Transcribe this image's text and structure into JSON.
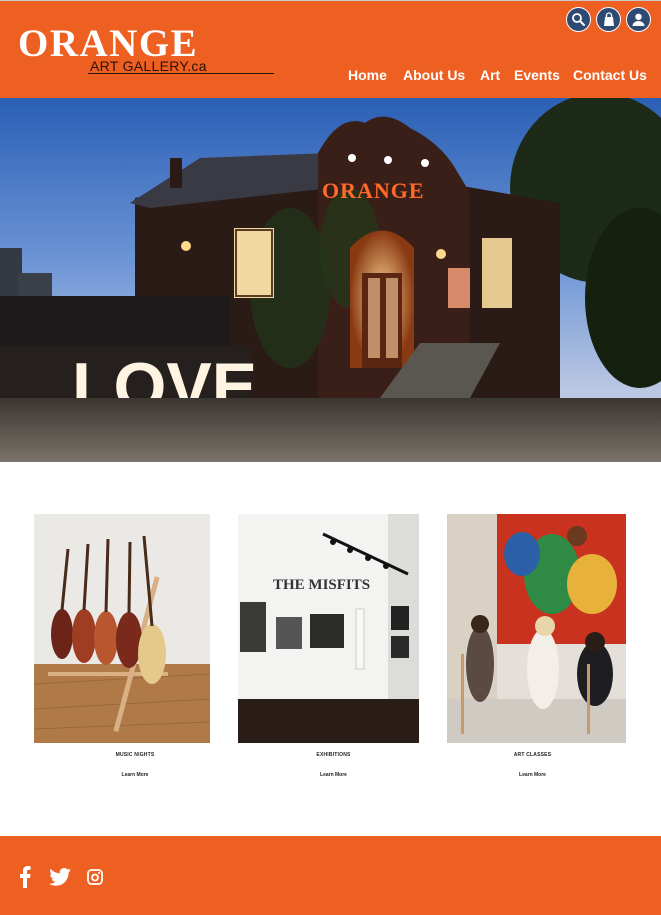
{
  "brand": {
    "name": "ORANGE",
    "subtitle": "ART GALLERY.ca",
    "color": "#ee5f22"
  },
  "header_icons": [
    "search-icon",
    "shopping-bag-icon",
    "user-icon"
  ],
  "nav": {
    "items": [
      {
        "label": "Home"
      },
      {
        "label": "About Us"
      },
      {
        "label": "Art"
      },
      {
        "label": "Events"
      },
      {
        "label": "Contact Us"
      }
    ]
  },
  "hero": {
    "sign_text": "LOVE",
    "building_sign": "ORANGE"
  },
  "cards": [
    {
      "title": "MUSIC NIGHTS",
      "link": "Learn More",
      "image": "guitars-on-stand"
    },
    {
      "title": "EXHIBITIONS",
      "link": "Learn More",
      "image": "gallery-wall",
      "wall_text": "THE MISFITS"
    },
    {
      "title": "ART CLASSES",
      "link": "Learn More",
      "image": "painting-class"
    }
  ],
  "footer": {
    "social_icons": [
      "facebook-icon",
      "twitter-icon",
      "instagram-icon"
    ]
  }
}
